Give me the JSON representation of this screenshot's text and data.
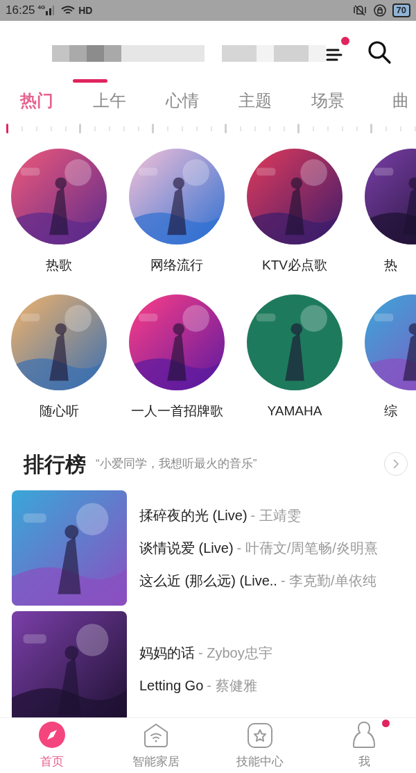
{
  "status_bar": {
    "time": "16:25",
    "network": "4G",
    "hd": "HD",
    "battery": "70"
  },
  "header": {
    "menu_dot": true
  },
  "tabs": [
    {
      "label": "热门",
      "selected": true
    },
    {
      "label": "上午",
      "selected": false
    },
    {
      "label": "心情",
      "selected": false
    },
    {
      "label": "主题",
      "selected": false
    },
    {
      "label": "场景",
      "selected": false
    },
    {
      "label": "曲",
      "selected": false
    }
  ],
  "playlist_rows": [
    [
      {
        "label": "热歌"
      },
      {
        "label": "网络流行"
      },
      {
        "label": "KTV必点歌"
      },
      {
        "label": "热"
      }
    ],
    [
      {
        "label": "随心听"
      },
      {
        "label": "一人一首招牌歌"
      },
      {
        "label": "YAMAHA"
      },
      {
        "label": "综"
      }
    ]
  ],
  "ranking": {
    "title": "排行榜",
    "subtitle": "“小爱同学，我想听最火的音乐”",
    "charts": [
      {
        "songs": [
          {
            "title": "揉碎夜的光 (Live)",
            "artist": "- 王靖雯"
          },
          {
            "title": "谈情说爱 (Live)",
            "artist": "- 叶蒨文/周笔畅/炎明熹"
          },
          {
            "title": "这么近 (那么远) (Live..",
            "artist": "- 李克勤/单依纯"
          }
        ]
      },
      {
        "songs": [
          {
            "title": "妈妈的话",
            "artist": "- Zyboy忠宇"
          },
          {
            "title": "Letting Go",
            "artist": "- 蔡健雅"
          }
        ]
      }
    ]
  },
  "bottom_nav": [
    {
      "kind": "compass",
      "label": "首页",
      "selected": true,
      "dot": false
    },
    {
      "kind": "home",
      "label": "智能家居",
      "selected": false,
      "dot": false
    },
    {
      "kind": "star",
      "label": "技能中心",
      "selected": false,
      "dot": false
    },
    {
      "kind": "person",
      "label": "我",
      "selected": false,
      "dot": true
    }
  ]
}
